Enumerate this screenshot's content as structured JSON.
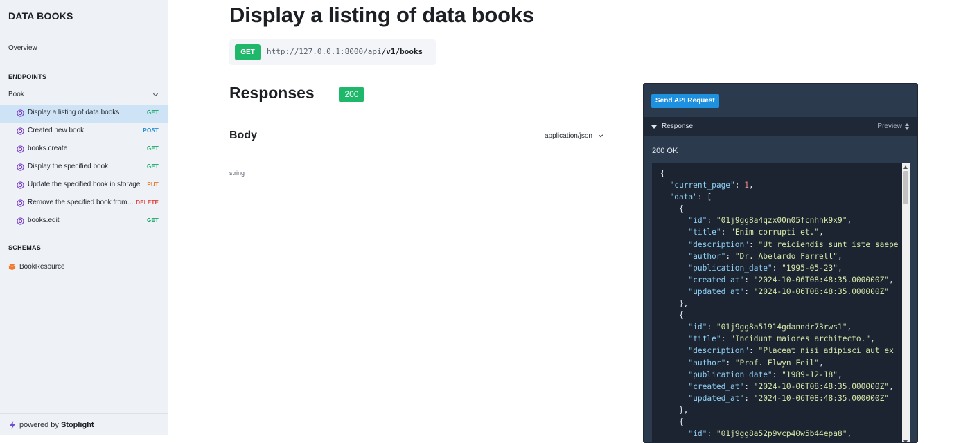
{
  "sidebar": {
    "brand": "DATA BOOKS",
    "overview": "Overview",
    "endpoints_title": "ENDPOINTS",
    "group": "Book",
    "items": [
      {
        "label": "Display a listing of data books",
        "method": "GET"
      },
      {
        "label": "Created new book",
        "method": "POST"
      },
      {
        "label": "books.create",
        "method": "GET"
      },
      {
        "label": "Display the specified book",
        "method": "GET"
      },
      {
        "label": "Update the specified book in storage",
        "method": "PUT"
      },
      {
        "label": "Remove the specified book from storage",
        "method": "DELETE"
      },
      {
        "label": "books.edit",
        "method": "GET"
      }
    ],
    "schemas_title": "SCHEMAS",
    "schema_item": "BookResource",
    "footer_prefix": "powered by ",
    "footer_brand": "Stoplight"
  },
  "main": {
    "title": "Display a listing of data books",
    "method": "GET",
    "url_base": "http://127.0.0.1:8000/api",
    "url_path": "/v1/books",
    "responses_title": "Responses",
    "status_code": "200",
    "body_title": "Body",
    "content_type": "application/json",
    "schema_type": "string"
  },
  "panel": {
    "send_button": "Send API Request",
    "response_label": "Response",
    "preview_label": "Preview",
    "status_text": "200 OK"
  },
  "code_lines": [
    {
      "t": "{"
    },
    {
      "t": "  \"current_page\": 1,"
    },
    {
      "t": "  \"data\": ["
    },
    {
      "t": "    {"
    },
    {
      "t": "      \"id\": \"01j9gg8a4qzx00n05fcnhhk9x9\","
    },
    {
      "t": "      \"title\": \"Enim corrupti et.\","
    },
    {
      "t": "      \"description\": \"Ut reiciendis sunt iste saepe"
    },
    {
      "t": "      \"author\": \"Dr. Abelardo Farrell\","
    },
    {
      "t": "      \"publication_date\": \"1995-05-23\","
    },
    {
      "t": "      \"created_at\": \"2024-10-06T08:48:35.000000Z\","
    },
    {
      "t": "      \"updated_at\": \"2024-10-06T08:48:35.000000Z\""
    },
    {
      "t": "    },"
    },
    {
      "t": "    {"
    },
    {
      "t": "      \"id\": \"01j9gg8a51914gdanndr73rws1\","
    },
    {
      "t": "      \"title\": \"Incidunt maiores architecto.\","
    },
    {
      "t": "      \"description\": \"Placeat nisi adipisci aut ex"
    },
    {
      "t": "      \"author\": \"Prof. Elwyn Feil\","
    },
    {
      "t": "      \"publication_date\": \"1989-12-18\","
    },
    {
      "t": "      \"created_at\": \"2024-10-06T08:48:35.000000Z\","
    },
    {
      "t": "      \"updated_at\": \"2024-10-06T08:48:35.000000Z\""
    },
    {
      "t": "    },"
    },
    {
      "t": "    {"
    },
    {
      "t": "      \"id\": \"01j9gg8a52p9vcp40w5b44epa8\","
    }
  ],
  "colors": {
    "get": "#15a865",
    "post": "#2590d8",
    "put": "#e8792a",
    "delete": "#e0453c",
    "active_bg": "#cfe3f6",
    "badge_green": "#1fb76a",
    "panel_bg": "#2c3a4d",
    "send_button": "#1e90e0"
  },
  "icons": [
    "endpoint-target-icon",
    "chevron-down-icon",
    "cube-icon",
    "bolt-icon",
    "caret-down-icon",
    "sort-arrows-icon"
  ]
}
